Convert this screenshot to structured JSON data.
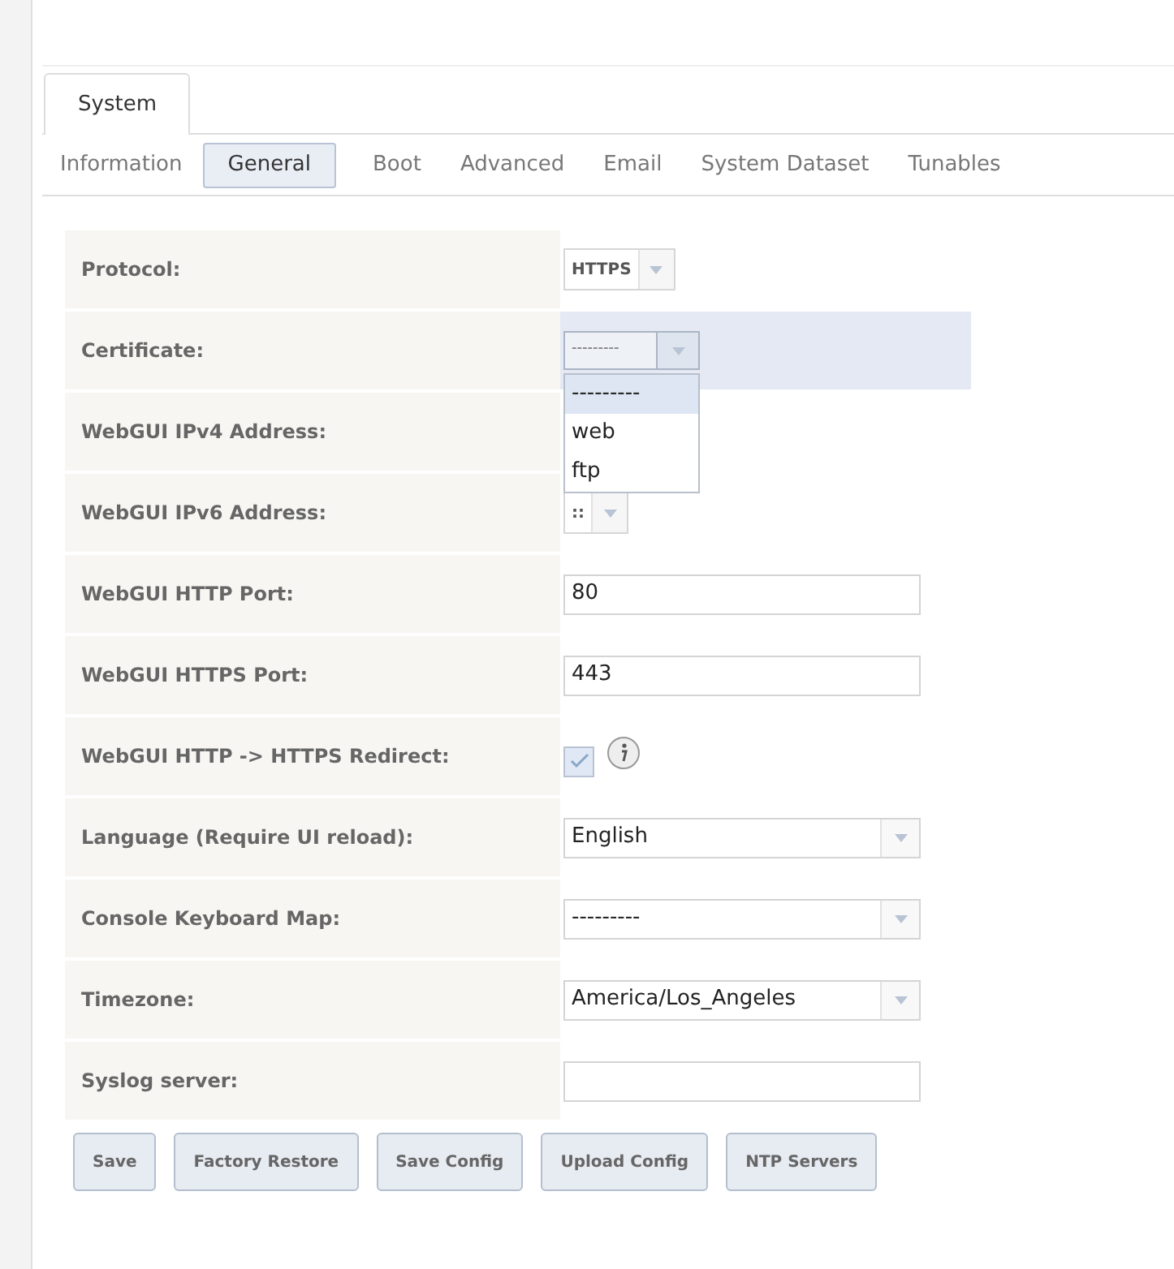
{
  "tabs": [
    {
      "label": "System",
      "selected": true
    }
  ],
  "subtabs": [
    {
      "label": "Information",
      "selected": false
    },
    {
      "label": "General",
      "selected": true
    },
    {
      "label": "Boot",
      "selected": false
    },
    {
      "label": "Advanced",
      "selected": false
    },
    {
      "label": "Email",
      "selected": false
    },
    {
      "label": "System Dataset",
      "selected": false
    },
    {
      "label": "Tunables",
      "selected": false
    }
  ],
  "fields": [
    {
      "label": "Protocol:",
      "kind": "small-select",
      "value": "HTTPS"
    },
    {
      "label": "Certificate:",
      "kind": "open-select",
      "value": "---------",
      "options": [
        {
          "label": "---------",
          "selected": true
        },
        {
          "label": "web",
          "selected": false
        },
        {
          "label": "ftp",
          "selected": false
        }
      ]
    },
    {
      "label": "WebGUI IPv4 Address:",
      "kind": "hidden"
    },
    {
      "label": "WebGUI IPv6 Address:",
      "kind": "small-select",
      "value": "::"
    },
    {
      "label": "WebGUI HTTP Port:",
      "kind": "text",
      "value": "80"
    },
    {
      "label": "WebGUI HTTPS Port:",
      "kind": "text",
      "value": "443"
    },
    {
      "label": "WebGUI HTTP -> HTTPS Redirect:",
      "kind": "checkbox",
      "checked": true
    },
    {
      "label": "Language (Require UI reload):",
      "kind": "select",
      "value": "English"
    },
    {
      "label": "Console Keyboard Map:",
      "kind": "select",
      "value": "---------"
    },
    {
      "label": "Timezone:",
      "kind": "select",
      "value": "America/Los_Angeles"
    },
    {
      "label": "Syslog server:",
      "kind": "text"
    }
  ],
  "buttons": [
    "Save",
    "Factory Restore",
    "Save Config",
    "Upload Config",
    "NTP Servers"
  ]
}
